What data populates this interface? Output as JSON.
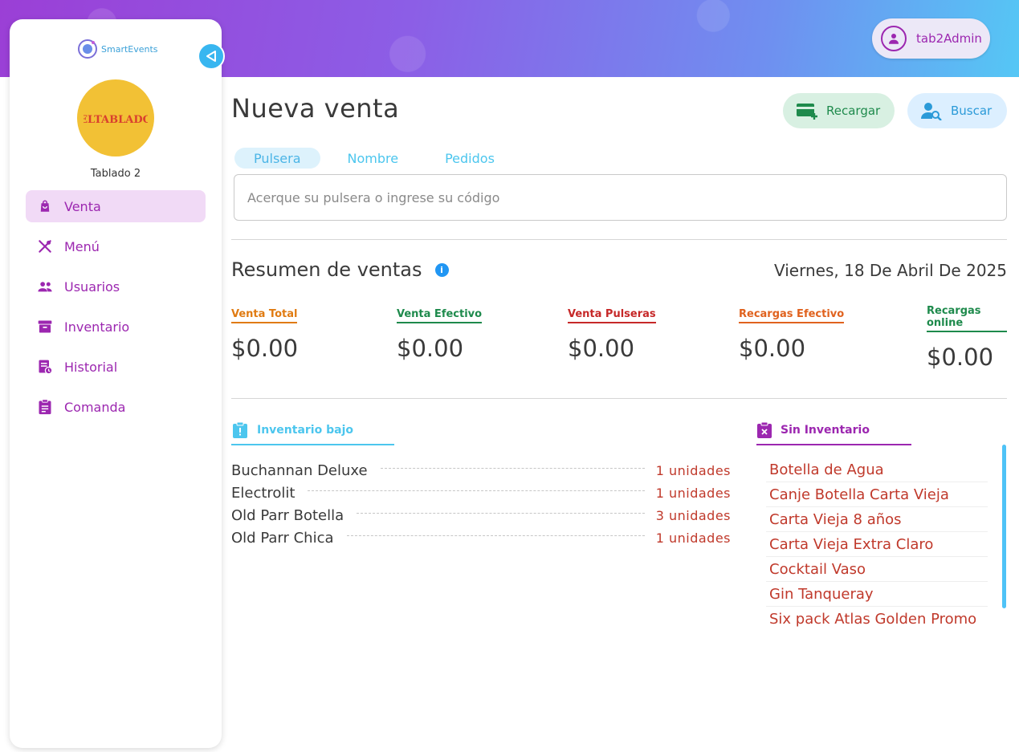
{
  "header": {
    "user_name": "tab2Admin"
  },
  "sidebar": {
    "logo_text": "SmartEvents",
    "venue_logo_text": "ELTABLADO",
    "venue_name": "Tablado 2",
    "items": [
      {
        "label": "Venta",
        "icon": "shopping-bag-icon",
        "active": true
      },
      {
        "label": "Menú",
        "icon": "utensils-icon",
        "active": false
      },
      {
        "label": "Usuarios",
        "icon": "users-icon",
        "active": false
      },
      {
        "label": "Inventario",
        "icon": "archive-icon",
        "active": false
      },
      {
        "label": "Historial",
        "icon": "history-icon",
        "active": false
      },
      {
        "label": "Comanda",
        "icon": "clipboard-icon",
        "active": false
      }
    ]
  },
  "main": {
    "title": "Nueva venta",
    "recargar_label": "Recargar",
    "buscar_label": "Buscar",
    "tabs": [
      "Pulsera",
      "Nombre",
      "Pedidos"
    ],
    "search_placeholder": "Acerque su pulsera o ingrese su código"
  },
  "summary": {
    "title": "Resumen de ventas",
    "date": "Viernes, 18 De Abril De 2025",
    "stats": [
      {
        "label": "Venta Total",
        "value": "$0.00",
        "color": "#e07b12"
      },
      {
        "label": "Venta Efectivo",
        "value": "$0.00",
        "color": "#1e8a4c"
      },
      {
        "label": "Venta Pulseras",
        "value": "$0.00",
        "color": "#c62828"
      },
      {
        "label": "Recargas Efectivo",
        "value": "$0.00",
        "color": "#e0621e"
      },
      {
        "label": "Recargas online",
        "value": "$0.00",
        "color": "#1e8a4c"
      }
    ]
  },
  "low_inventory": {
    "title": "Inventario bajo",
    "items": [
      {
        "name": "Buchannan Deluxe",
        "qty": "1 unidades"
      },
      {
        "name": "Electrolit",
        "qty": "1 unidades"
      },
      {
        "name": "Old Parr Botella",
        "qty": "3 unidades"
      },
      {
        "name": "Old Parr Chica",
        "qty": "1 unidades"
      }
    ]
  },
  "no_inventory": {
    "title": "Sin Inventario",
    "items": [
      "Botella de Agua",
      "Canje Botella Carta Vieja",
      "Carta Vieja 8 años",
      "Carta Vieja Extra Claro",
      "Cocktail Vaso",
      "Gin Tanqueray",
      "Six pack Atlas Golden Promo"
    ]
  },
  "colors": {
    "accent_purple": "#9c27b0",
    "accent_blue": "#4cc6ee",
    "danger_red": "#c0392b"
  }
}
